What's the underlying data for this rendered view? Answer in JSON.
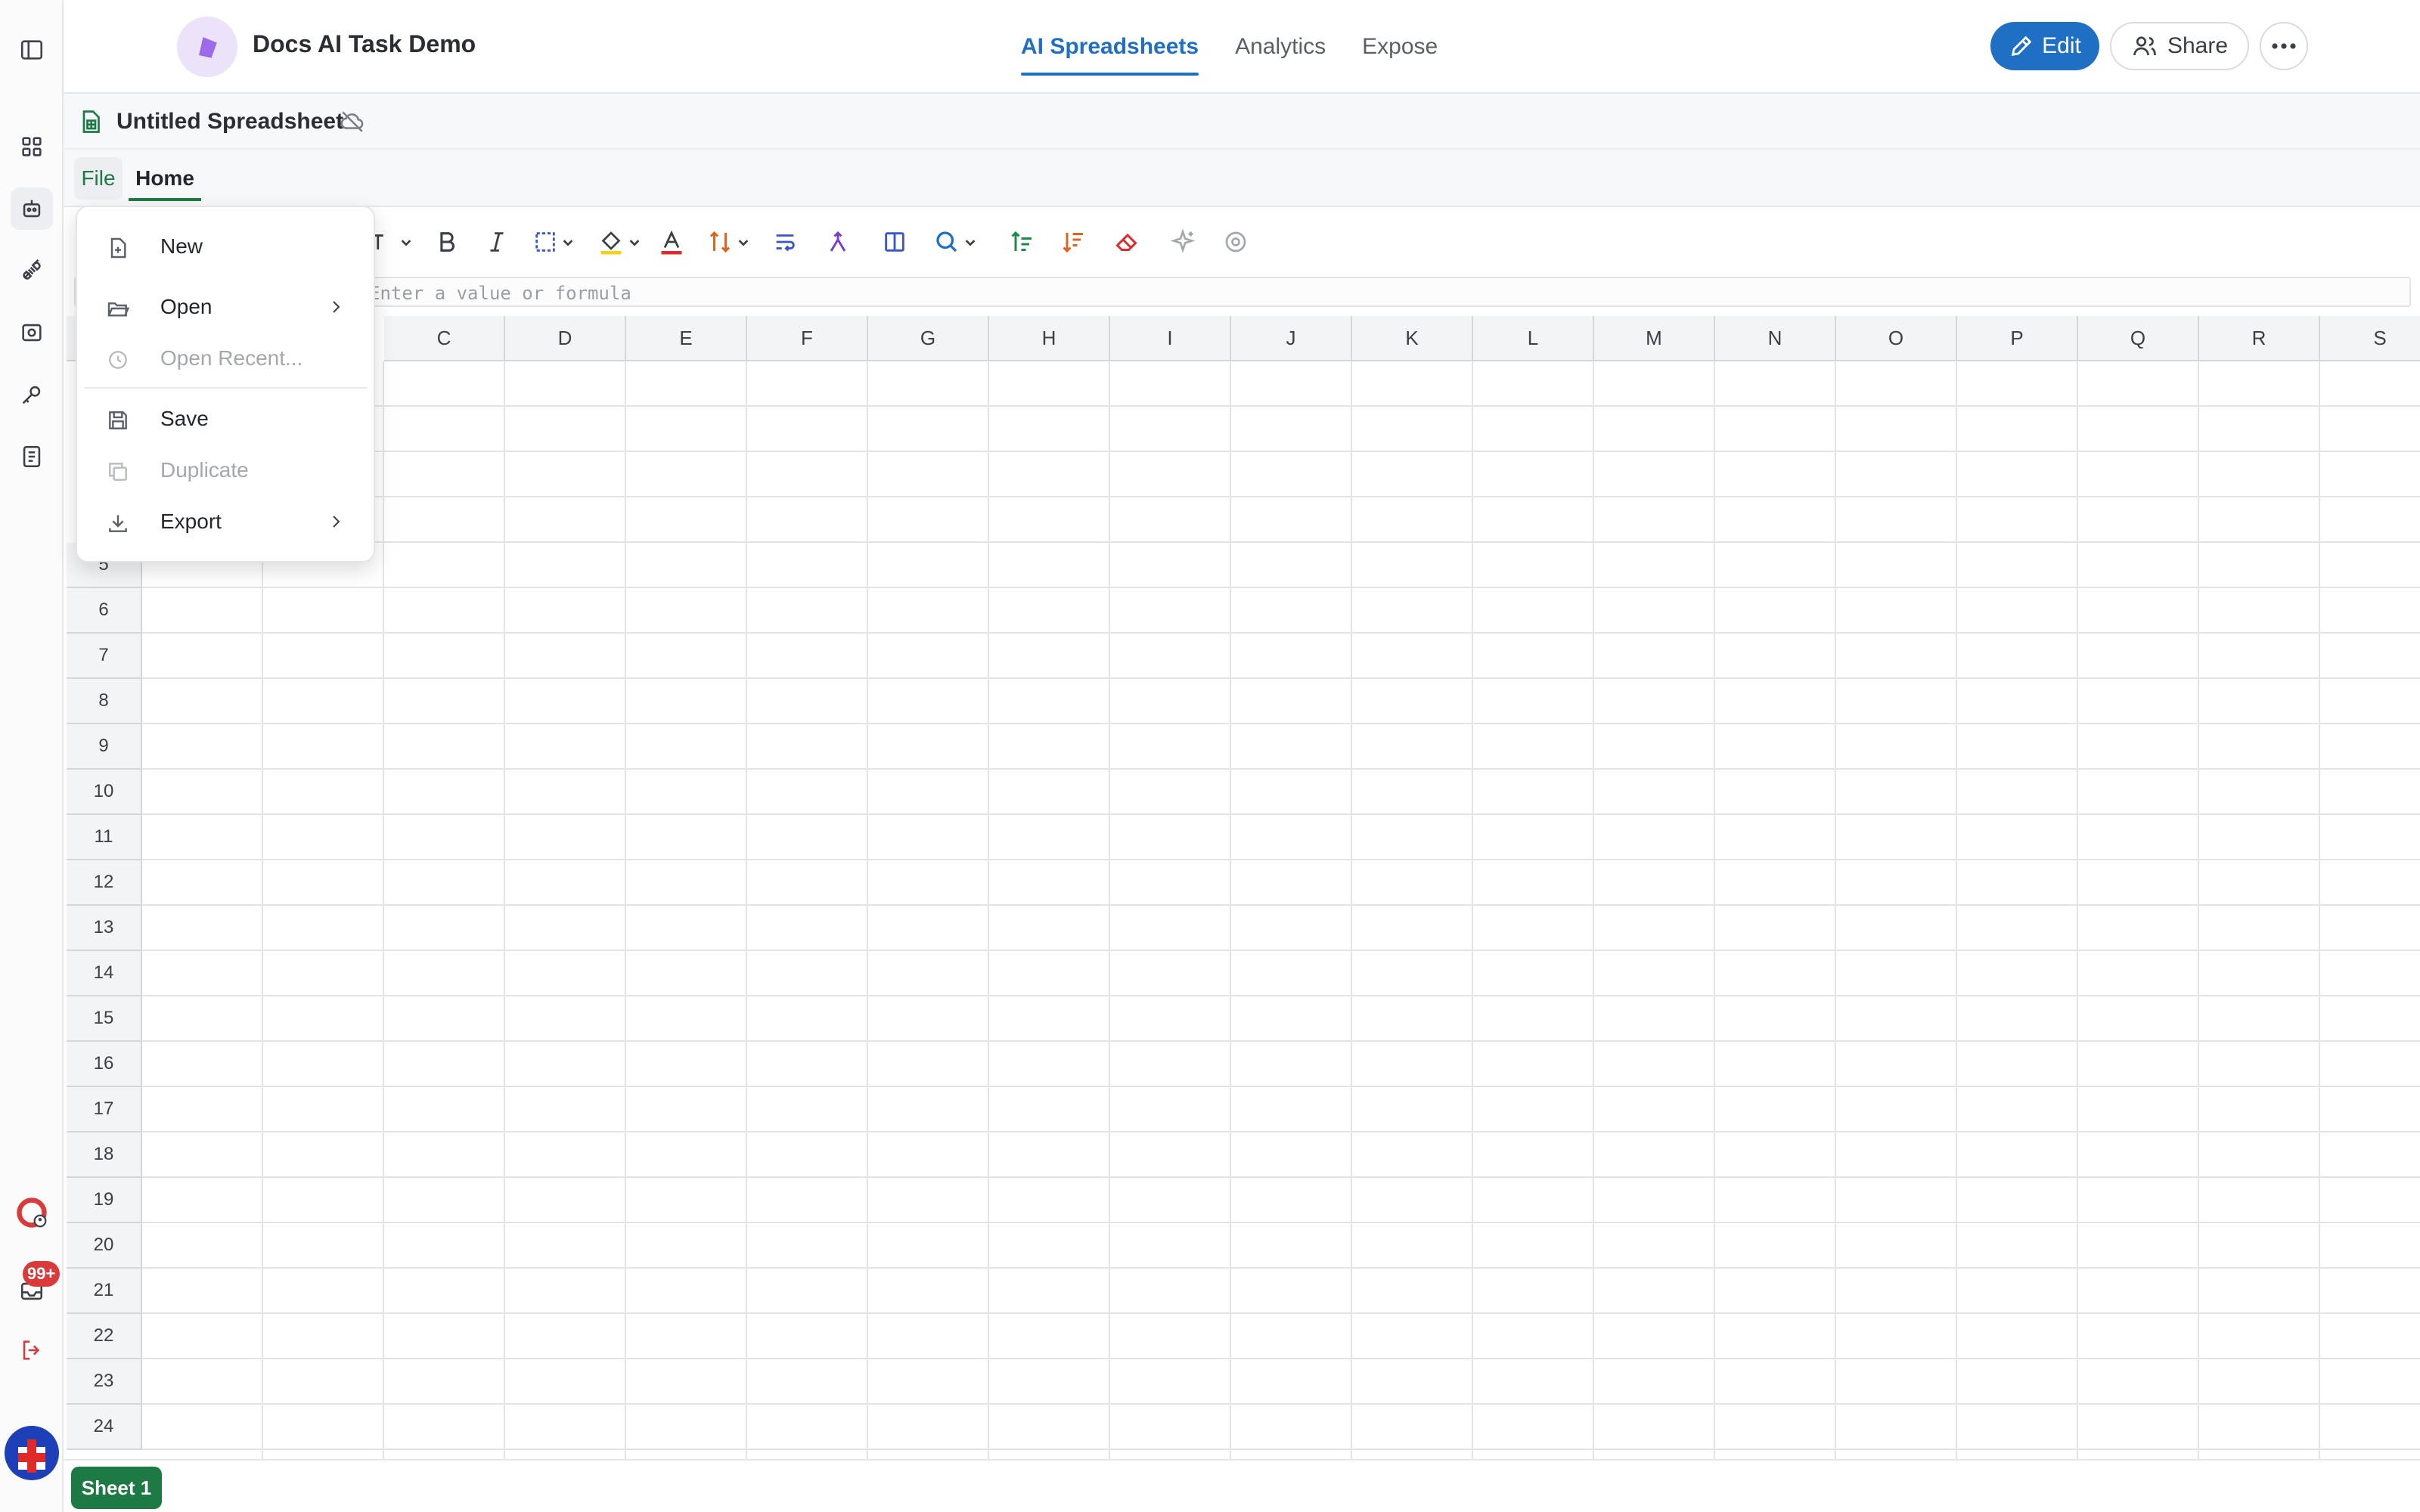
{
  "app": {
    "title": "Docs AI Task Demo",
    "colors": {
      "accent": "#1f6fc5",
      "sheet_green": "#1e7a45",
      "badge_red": "#d93a3a"
    }
  },
  "nav": {
    "tabs": [
      {
        "label": "AI Spreadsheets",
        "active": true
      },
      {
        "label": "Analytics",
        "active": false
      },
      {
        "label": "Expose",
        "active": false
      }
    ]
  },
  "actions": {
    "edit": "Edit",
    "share": "Share"
  },
  "rail": {
    "icons": [
      "sidebar-toggle-icon",
      "grid-icon",
      "robot-icon",
      "plug-icon",
      "scan-icon",
      "key-icon",
      "notebook-icon",
      "lifebuoy-icon",
      "inbox-icon",
      "logout-icon"
    ],
    "inbox_badge": "99+"
  },
  "document": {
    "title": "Untitled Spreadsheet"
  },
  "menu": {
    "file": "File",
    "home": "Home"
  },
  "toolbar": {
    "icons": [
      "font-icon",
      "bold-icon",
      "italic-icon",
      "border-icon",
      "fill-color-icon",
      "text-color-icon",
      "sort-icon",
      "wrap-icon",
      "merge-icon",
      "columns-icon",
      "search-icon",
      "sort-asc-icon",
      "sort-desc-icon",
      "eraser-icon",
      "sparkle-icon",
      "target-icon"
    ]
  },
  "formula_bar": {
    "placeholder": "Enter a value or formula"
  },
  "grid": {
    "columns": [
      "C",
      "D",
      "E",
      "F",
      "G",
      "H",
      "I",
      "J",
      "K",
      "L",
      "M",
      "N",
      "O",
      "P",
      "Q",
      "R",
      "S"
    ],
    "rows": [
      "5",
      "6",
      "7",
      "8",
      "9",
      "10",
      "11",
      "12",
      "13",
      "14",
      "15",
      "16",
      "17",
      "18",
      "19",
      "20",
      "21",
      "22",
      "23",
      "24"
    ]
  },
  "sheets": [
    {
      "name": "Sheet 1",
      "active": true
    }
  ],
  "file_menu": {
    "items": [
      {
        "label": "New",
        "icon": "file-plus-icon",
        "disabled": false
      },
      {
        "label": "Open",
        "icon": "folder-open-icon",
        "disabled": false,
        "submenu": true
      },
      {
        "label": "Open Recent...",
        "icon": "clock-icon",
        "disabled": true
      },
      {
        "label": "Save",
        "icon": "save-icon",
        "disabled": false
      },
      {
        "label": "Duplicate",
        "icon": "duplicate-icon",
        "disabled": true
      },
      {
        "label": "Export",
        "icon": "download-icon",
        "disabled": false,
        "submenu": true
      }
    ]
  }
}
